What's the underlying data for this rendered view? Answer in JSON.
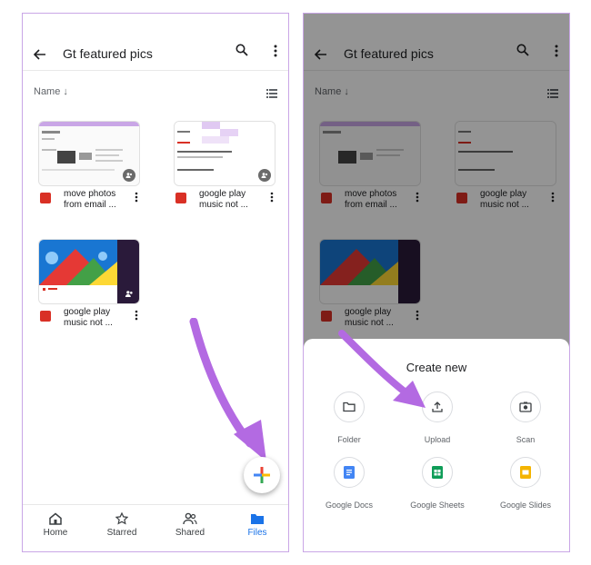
{
  "left": {
    "header": {
      "title": "Gt featured pics"
    },
    "sort_label": "Name",
    "files": [
      {
        "name": "move photos from email ..."
      },
      {
        "name": "google play music not ..."
      },
      {
        "name": "google play music not ..."
      }
    ],
    "nav": [
      {
        "label": "Home"
      },
      {
        "label": "Starred"
      },
      {
        "label": "Shared"
      },
      {
        "label": "Files"
      }
    ]
  },
  "right": {
    "header": {
      "title": "Gt featured pics"
    },
    "sort_label": "Name",
    "files": [
      {
        "name": "move photos from email ..."
      },
      {
        "name": "google play music not ..."
      },
      {
        "name": "google play music not ..."
      }
    ],
    "sheet": {
      "title": "Create new",
      "options": [
        {
          "label": "Folder",
          "icon": "folder-icon"
        },
        {
          "label": "Upload",
          "icon": "upload-icon"
        },
        {
          "label": "Scan",
          "icon": "camera-icon"
        },
        {
          "label": "Google Docs",
          "icon": "docs-icon"
        },
        {
          "label": "Google Sheets",
          "icon": "sheets-icon"
        },
        {
          "label": "Google Slides",
          "icon": "slides-icon"
        }
      ]
    }
  },
  "colors": {
    "accent": "#1a73e8",
    "annotation_arrow": "#b36ae2",
    "image_file": "#d93025",
    "docs": "#4285f4",
    "sheets": "#0f9d58",
    "slides": "#f4b400"
  }
}
